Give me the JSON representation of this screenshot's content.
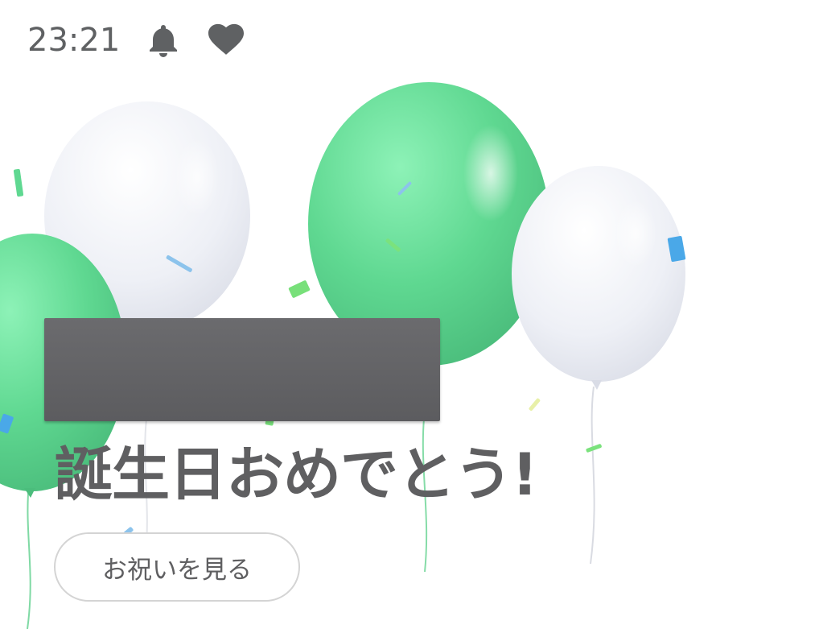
{
  "status_bar": {
    "time": "23:21",
    "icons": [
      "bell-icon",
      "heart-icon"
    ],
    "color": "#5f6163"
  },
  "celebration": {
    "headline": "誕生日おめでとう!",
    "view_button_label": "お祝いを見る",
    "balloon_colors": {
      "green": "#6ddb9a",
      "white": "#eef0f6"
    },
    "text_color": "#5f5f61"
  }
}
